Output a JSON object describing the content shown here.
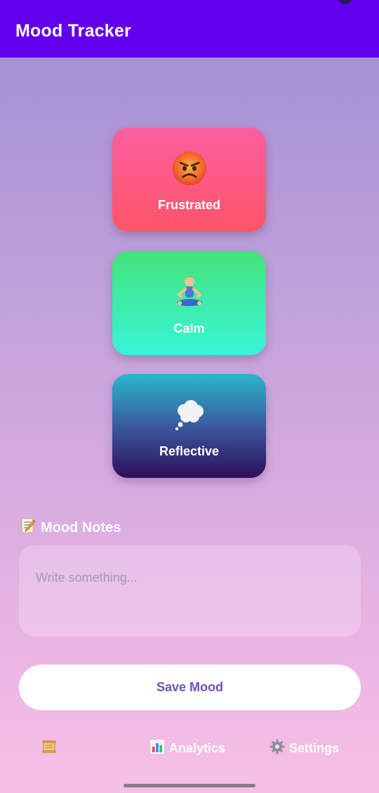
{
  "appbar": {
    "title": "Mood Tracker"
  },
  "moods": [
    {
      "label": "Frustrated",
      "icon": "angry-face-icon"
    },
    {
      "label": "Calm",
      "icon": "meditating-person-icon"
    },
    {
      "label": "Reflective",
      "icon": "thought-bubble-icon"
    }
  ],
  "notes": {
    "title": "Mood Notes",
    "title_icon": "memo-icon",
    "placeholder": "Write something..."
  },
  "save_button": {
    "label": "Save Mood"
  },
  "nav": {
    "history_icon": "scroll-icon",
    "analytics_label": "Analytics",
    "analytics_icon": "bar-chart-icon",
    "settings_label": "Settings",
    "settings_icon": "gear-icon"
  },
  "colors": {
    "appbar": "#6200ee",
    "frustrated": "#ff5567",
    "calm": "#37f5d7",
    "reflective": "#2e0d5b",
    "save_text": "#6e4fc7"
  }
}
